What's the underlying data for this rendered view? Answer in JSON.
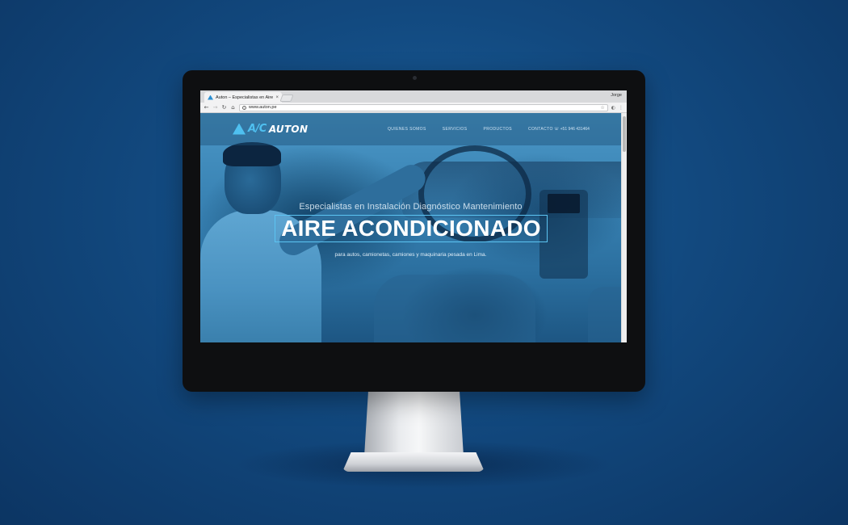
{
  "browser": {
    "tab_title": "Auton – Especialistas en Aire",
    "tab_close": "×",
    "profile_name": "Jorge",
    "url": "www.auton.pe",
    "icons": {
      "back": "←",
      "forward": "→",
      "reload": "↻",
      "home": "⌂",
      "info": "i",
      "star": "☆",
      "extension": "◐",
      "menu": "⋮"
    }
  },
  "site": {
    "logo": {
      "ac": "A/C",
      "name": "AUTON"
    },
    "nav": [
      "QUIENES SOMOS",
      "SERVICIOS",
      "PRODUCTOS",
      "CONTACTO"
    ],
    "phone": "☏ +51 946 431464",
    "hero": {
      "subtitle": "Especialistas en Instalación Diagnóstico Mantenimiento",
      "title": "AIRE ACONDICIONADO",
      "description": "para autos, camionetas, camiones y maquinaria pesada en Lima."
    }
  },
  "device": {
    "apple_logo": ""
  },
  "colors": {
    "background": "#12497f",
    "accent": "#4fc0f0",
    "monitor_bezel": "#0e0f11"
  }
}
